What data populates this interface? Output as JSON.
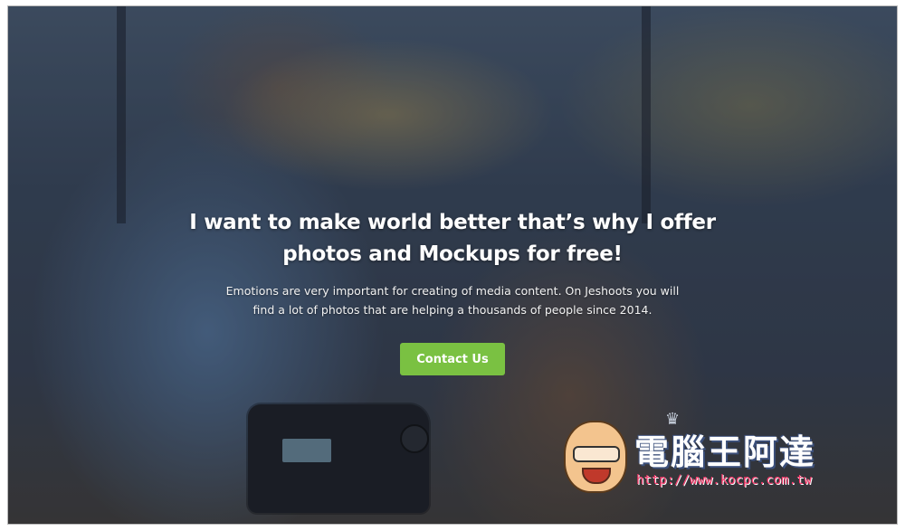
{
  "hero": {
    "title_line1": "I want to make world better that’s why I offer",
    "title_line2": "photos and Mockups for free!",
    "subtitle_line1": "Emotions are very important for creating of media content. On Jeshoots you will",
    "subtitle_line2": "find a lot of photos that are helping a thousands of people since 2014.",
    "cta_label": "Contact Us",
    "cta_color": "#7ac142"
  },
  "watermark": {
    "title": "電腦王阿達",
    "url": "http://www.kocpc.com.tw"
  }
}
